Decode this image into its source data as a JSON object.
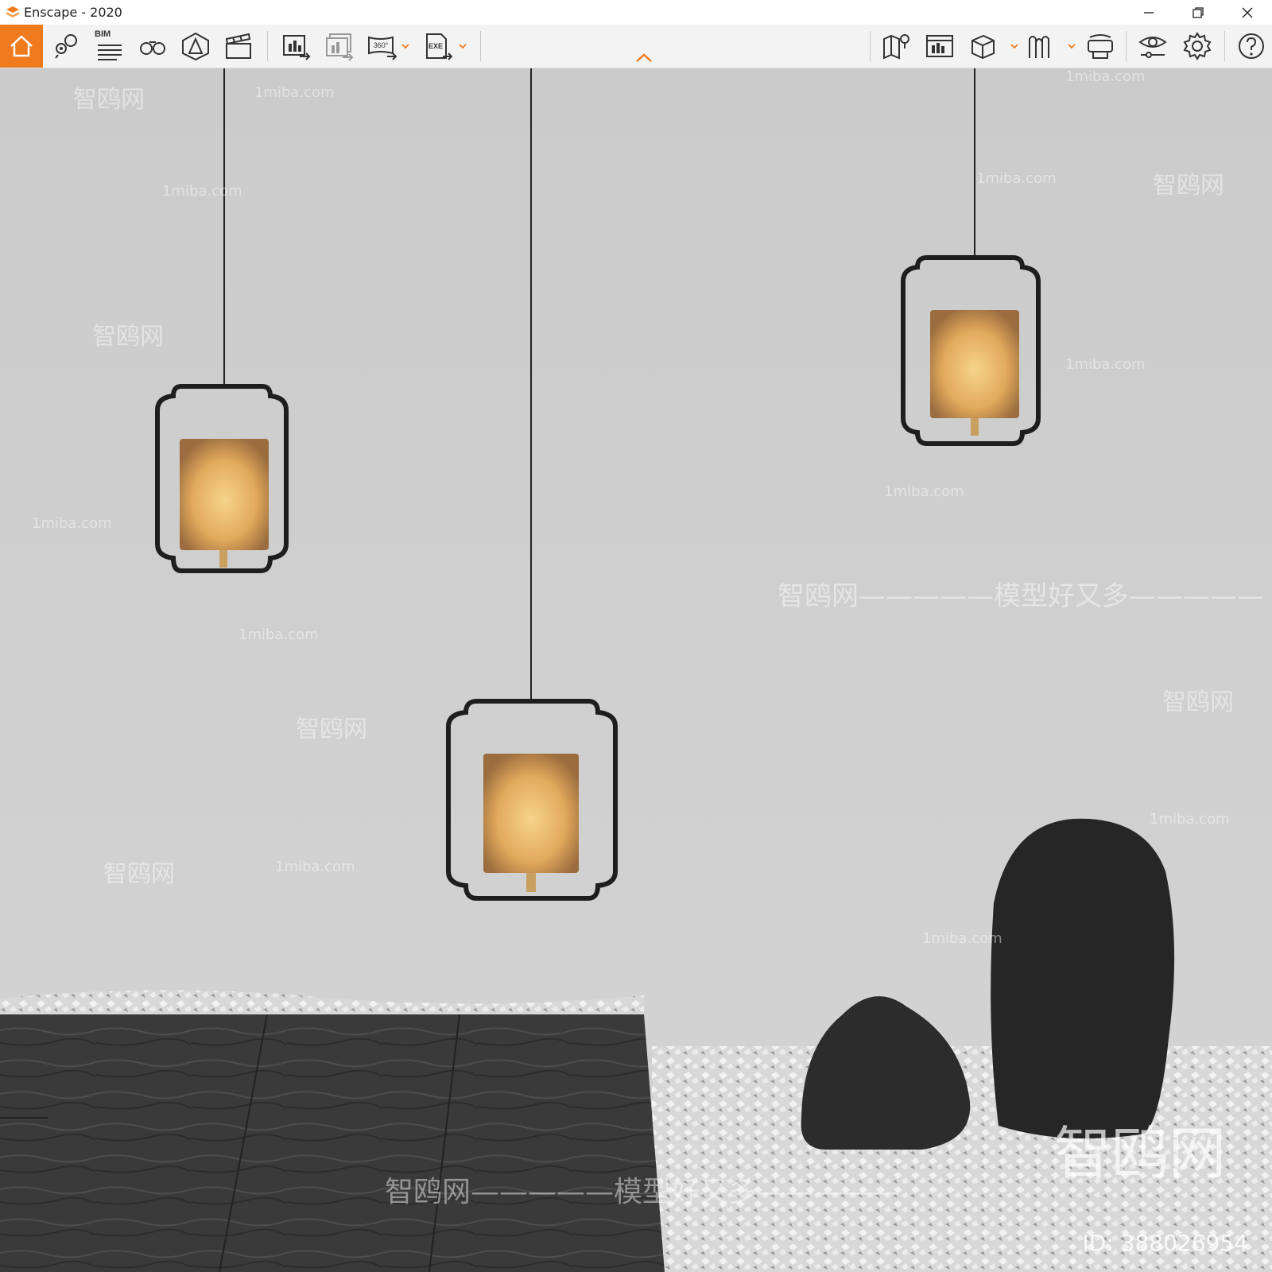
{
  "app": {
    "title": "Enscape - 2020",
    "accent_color": "#f07b1d"
  },
  "window_controls": [
    {
      "name": "minimize-icon"
    },
    {
      "name": "restore-icon"
    },
    {
      "name": "close-icon"
    }
  ],
  "toolbar": {
    "bim_label": "BIM",
    "left_tools": [
      "home-icon",
      "location-pin-icon",
      "bim-list-icon",
      "binoculars-icon",
      "perspective-icon",
      "clapperboard-icon",
      "render-screenshot-icon",
      "batch-render-icon",
      "panorama-360-icon",
      "exe-export-icon"
    ],
    "panorama_label": "360°",
    "exe_label": "EXE",
    "right_tools": [
      "map-icon",
      "asset-library-icon",
      "cube-icon",
      "views-icon",
      "vr-headset-icon",
      "visual-settings-icon",
      "settings-gear-icon",
      "help-icon"
    ]
  },
  "watermarks": {
    "site": "1miba.com",
    "brand": "智鸥网",
    "brand_long": "智鸥网—————模型好又多—————",
    "id_text": "ID: 388026954"
  },
  "scene": {
    "wall_color": "#cfcfcf",
    "floor_wood_color": "#3a3a3a",
    "gravel_color": "#e6e6e6",
    "rock_color": "#2a2a2a",
    "lamp_glow_color": "#f2c26b"
  }
}
